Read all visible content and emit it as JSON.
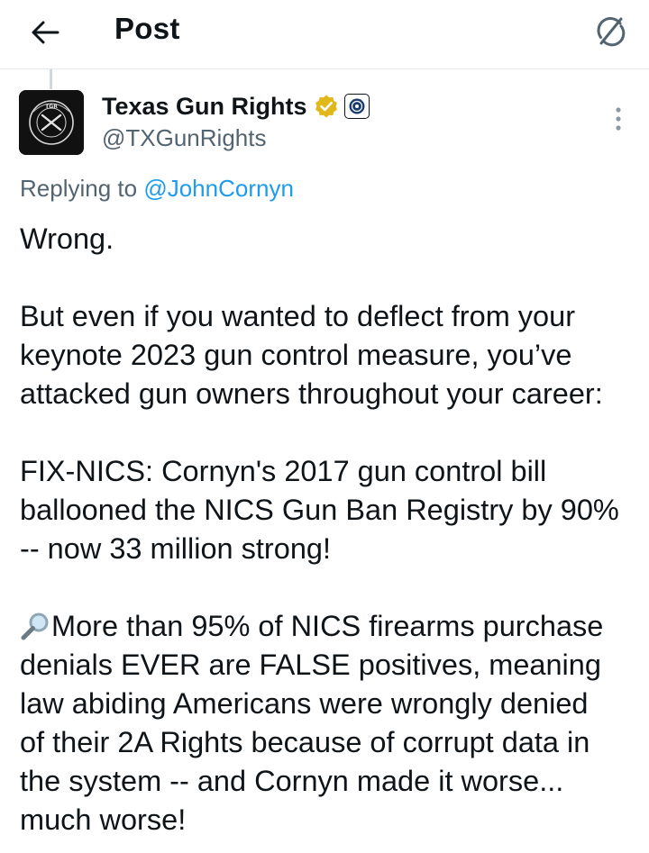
{
  "header": {
    "title": "Post",
    "back_icon": "arrow-left-icon",
    "right_icon": "grok-icon"
  },
  "author": {
    "name": "Texas Gun Rights",
    "handle": "@TXGunRights",
    "verified_icon": "gold-verified-badge-icon",
    "affiliate_icon": "affiliate-badge-icon",
    "verified_color": "#e2b719",
    "avatar_icon": "texas-gun-rights-logo"
  },
  "reply": {
    "prefix": "Replying to",
    "mention": "@JohnCornyn",
    "mention_color": "#1d9bf0"
  },
  "body": {
    "p1": "Wrong.",
    "p2_lines": [
      "But even if you wanted to deflect from your",
      "keynote 2023 gun control measure, you’ve",
      "attacked gun owners throughout your career:"
    ],
    "p3_lines": [
      "FIX-NICS: Cornyn's 2017 gun control bill",
      "ballooned the NICS Gun Ban Registry by 90%",
      "-- now 33 million strong!"
    ],
    "p4_emoji": "magnifying-glass-emoji",
    "p4_lines": [
      "More than 95% of NICS firearms purchase",
      "denials EVER are FALSE positives, meaning",
      "law abiding Americans were wrongly denied",
      "of their 2A Rights because of corrupt data in",
      "the system -- and Cornyn made it worse...",
      "much worse!"
    ]
  },
  "more_icon": "more-vertical-icon"
}
